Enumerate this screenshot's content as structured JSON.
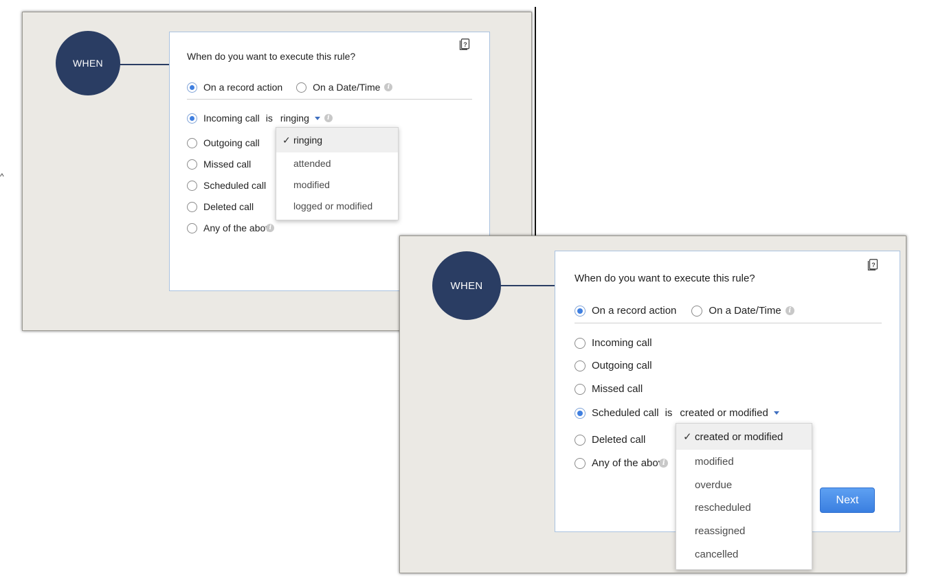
{
  "common": {
    "when_label": "WHEN",
    "question": "When do you want to execute this rule?",
    "mode_record": "On a record action",
    "mode_datetime": "On a Date/Time",
    "is_word": "is",
    "info_glyph": "i",
    "check_glyph": "✓",
    "edge_glyph": "^",
    "icons": {
      "help": "help-book-icon",
      "info": "info-icon",
      "caret": "caret-down-icon",
      "check": "check-icon"
    },
    "colors": {
      "circle": "#2a3d63",
      "radio_selected": "#3f7fe0",
      "next_button": "#3a7fe0",
      "card_border": "#a9c2df"
    }
  },
  "screen1": {
    "options": [
      "Incoming call",
      "Outgoing call",
      "Missed call",
      "Scheduled call",
      "Deleted call",
      "Any of the abov"
    ],
    "selected_option": "Incoming call",
    "dropdown_value": "ringing",
    "menu_items": [
      "ringing",
      "attended",
      "modified",
      "logged or modified"
    ],
    "menu_selected": "ringing"
  },
  "screen2": {
    "options": [
      "Incoming call",
      "Outgoing call",
      "Missed call",
      "Scheduled call",
      "Deleted call",
      "Any of the abov"
    ],
    "selected_option": "Scheduled call",
    "dropdown_value": "created or modified",
    "menu_items": [
      "created or modified",
      "modified",
      "overdue",
      "rescheduled",
      "reassigned",
      "cancelled"
    ],
    "menu_selected": "created or modified",
    "next_label": "Next"
  }
}
